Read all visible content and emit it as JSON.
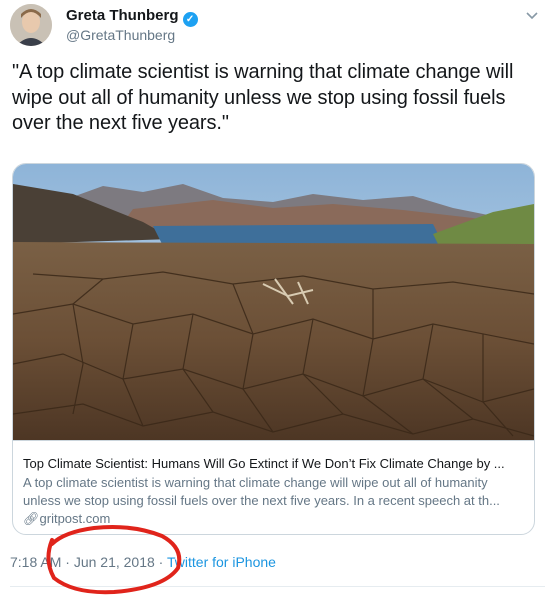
{
  "user": {
    "name": "Greta Thunberg",
    "handle": "@GretaThunberg",
    "verified_icon": "verified-badge-icon",
    "menu_icon": "chevron-down-icon"
  },
  "tweet": {
    "text": "\"A top climate scientist is warning that climate change will wipe out all of humanity unless we stop using fossil fuels over the next five years.\""
  },
  "card": {
    "title": "Top Climate Scientist: Humans Will Go Extinct if We Don’t Fix Climate Change by ...",
    "description": "A top climate scientist is warning that climate change will wipe out all of humanity unless we stop using fossil fuels over the next five years. In a recent speech at th...",
    "link_icon": "link-icon",
    "domain": "gritpost.com"
  },
  "meta": {
    "time": "7:18 AM",
    "separator": " · ",
    "date": "Jun 21, 2018",
    "source": "Twitter for iPhone"
  },
  "colors": {
    "link_blue": "#1b95e0",
    "verified_blue": "#1da1f2",
    "annotation_red": "#e0241b",
    "secondary_text": "#657786"
  }
}
